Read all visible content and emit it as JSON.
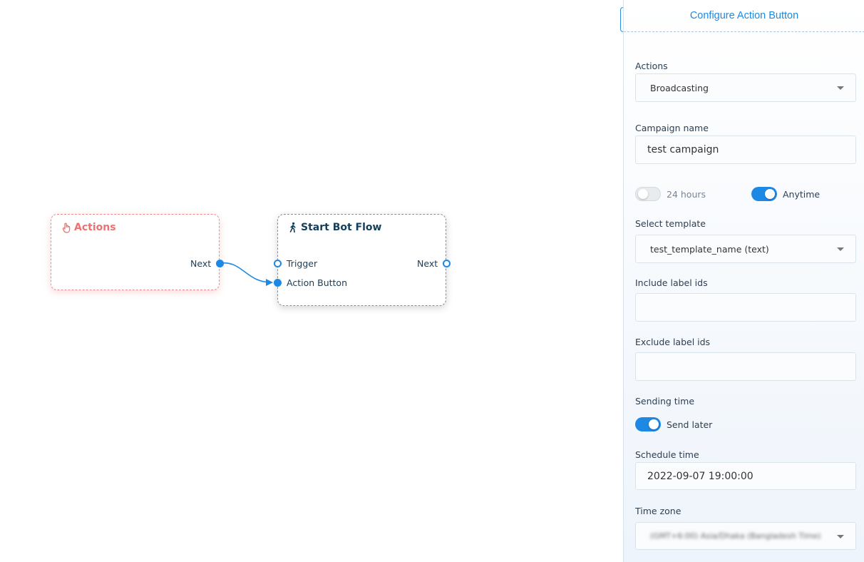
{
  "canvas": {
    "nodes": {
      "actions": {
        "title": "Actions",
        "icon": "pointer-hand-icon",
        "color": "#f07070",
        "ports": {
          "next_label": "Next"
        }
      },
      "start_bot_flow": {
        "title": "Start Bot Flow",
        "icon": "walking-person-icon",
        "color": "#133e5a",
        "ports": {
          "trigger_label": "Trigger",
          "action_button_label": "Action Button",
          "next_label": "Next"
        }
      }
    },
    "edge": {
      "from": "actions.next",
      "to": "start_bot_flow.action_button",
      "color": "#1e88e5"
    }
  },
  "panel": {
    "title": "Configure Action Button",
    "actions": {
      "label": "Actions",
      "value": "Broadcasting"
    },
    "campaign_name": {
      "label": "Campaign name",
      "value": "test campaign"
    },
    "window_toggles": [
      {
        "label": "24 hours",
        "on": false
      },
      {
        "label": "Anytime",
        "on": true
      }
    ],
    "select_template": {
      "label": "Select template",
      "value": "test_template_name (text)"
    },
    "include_label_ids": {
      "label": "Include label ids",
      "value": ""
    },
    "exclude_label_ids": {
      "label": "Exclude label ids",
      "value": ""
    },
    "sending_time": {
      "label": "Sending time",
      "toggle_label": "Send later",
      "on": true
    },
    "schedule_time": {
      "label": "Schedule time",
      "value": "2022-09-07 19:00:00"
    },
    "time_zone": {
      "label": "Time zone",
      "value": "(GMT+6:00) Asia/Dhaka (Bangladesh Time)"
    }
  },
  "colors": {
    "accent": "#1e88e5",
    "actions_node": "#f07070",
    "text": "#2c3e50"
  }
}
